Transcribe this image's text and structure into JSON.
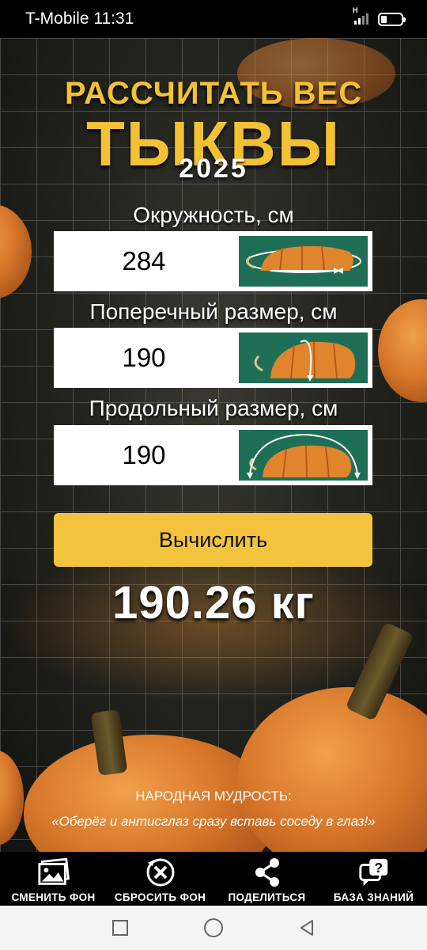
{
  "status_bar": {
    "carrier_time": "T-Mobile 11:31",
    "network_label": "H"
  },
  "title": {
    "line1": "РАССЧИТАТЬ ВЕС",
    "line2": "ТЫКВЫ",
    "year": "2025"
  },
  "fields": [
    {
      "label": "Окружность, см",
      "value": "284",
      "illustration": "pumpkin-circumference-icon"
    },
    {
      "label": "Поперечный размер, см",
      "value": "190",
      "illustration": "pumpkin-cross-size-icon"
    },
    {
      "label": "Продольный размер, см",
      "value": "190",
      "illustration": "pumpkin-length-icon"
    }
  ],
  "calculate_button": {
    "label": "Вычислить"
  },
  "result": {
    "text": "190.26 кг"
  },
  "wisdom": {
    "title": "НАРОДНАЯ МУДРОСТЬ:",
    "text": "«Оберёг и антисглаз сразу вставь соседу в глаз!»"
  },
  "bottom_nav": [
    {
      "label": "СМЕНИТЬ ФОН",
      "icon": "image-icon"
    },
    {
      "label": "СБРОСИТЬ ФОН",
      "icon": "reset-icon"
    },
    {
      "label": "ПОДЕЛИТЬСЯ",
      "icon": "share-icon"
    },
    {
      "label": "БАЗА ЗНАНИЙ",
      "icon": "help-chat-icon"
    }
  ],
  "colors": {
    "accent": "#f2c43e",
    "title": "#f2c233",
    "illustration_bg": "#1f6e56",
    "pumpkin": "#e0842e"
  }
}
